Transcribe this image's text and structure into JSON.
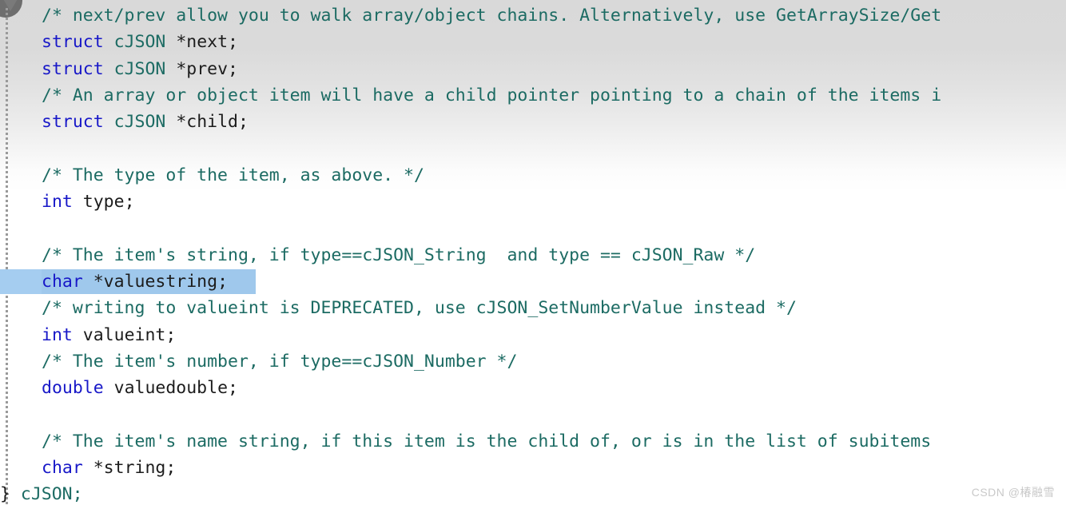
{
  "editor": {
    "language": "C",
    "colors": {
      "comment": "#1c6b63",
      "keyword": "#1818c8",
      "identifier": "#1c1c1c",
      "type": "#1c6b63",
      "selection_background": "#a5cdf0",
      "editor_background": "#ffffff"
    },
    "lines": [
      {
        "index": 0,
        "indent": true,
        "selected": false,
        "tokens": [
          {
            "kind": "cmt",
            "text": "/* next/prev allow you to walk array/object chains. Alternatively, use GetArraySize/Get"
          }
        ]
      },
      {
        "index": 1,
        "indent": true,
        "selected": false,
        "tokens": [
          {
            "kind": "kw",
            "text": "struct"
          },
          {
            "kind": "plain",
            "text": " "
          },
          {
            "kind": "typ",
            "text": "cJSON"
          },
          {
            "kind": "plain",
            "text": " "
          },
          {
            "kind": "id",
            "text": "*next;"
          }
        ]
      },
      {
        "index": 2,
        "indent": true,
        "selected": false,
        "tokens": [
          {
            "kind": "kw",
            "text": "struct"
          },
          {
            "kind": "plain",
            "text": " "
          },
          {
            "kind": "typ",
            "text": "cJSON"
          },
          {
            "kind": "plain",
            "text": " "
          },
          {
            "kind": "id",
            "text": "*prev;"
          }
        ]
      },
      {
        "index": 3,
        "indent": true,
        "selected": false,
        "tokens": [
          {
            "kind": "cmt",
            "text": "/* An array or object item will have a child pointer pointing to a chain of the items i"
          }
        ]
      },
      {
        "index": 4,
        "indent": true,
        "selected": false,
        "tokens": [
          {
            "kind": "kw",
            "text": "struct"
          },
          {
            "kind": "plain",
            "text": " "
          },
          {
            "kind": "typ",
            "text": "cJSON"
          },
          {
            "kind": "plain",
            "text": " "
          },
          {
            "kind": "id",
            "text": "*child;"
          }
        ]
      },
      {
        "index": 5,
        "indent": true,
        "selected": false,
        "tokens": []
      },
      {
        "index": 6,
        "indent": true,
        "selected": false,
        "tokens": [
          {
            "kind": "cmt",
            "text": "/* The type of the item, as above. */"
          }
        ]
      },
      {
        "index": 7,
        "indent": true,
        "selected": false,
        "tokens": [
          {
            "kind": "kw",
            "text": "int"
          },
          {
            "kind": "plain",
            "text": " "
          },
          {
            "kind": "id",
            "text": "type;"
          }
        ]
      },
      {
        "index": 8,
        "indent": true,
        "selected": false,
        "tokens": []
      },
      {
        "index": 9,
        "indent": true,
        "selected": false,
        "tokens": [
          {
            "kind": "cmt",
            "text": "/* The item's string, if type==cJSON_String  and type == cJSON_Raw */"
          }
        ]
      },
      {
        "index": 10,
        "indent": true,
        "selected": true,
        "tokens": [
          {
            "kind": "kw",
            "text": "char"
          },
          {
            "kind": "plain",
            "text": " "
          },
          {
            "kind": "id",
            "text": "*valuestring;"
          }
        ]
      },
      {
        "index": 11,
        "indent": true,
        "selected": false,
        "tokens": [
          {
            "kind": "cmt",
            "text": "/* writing to valueint is DEPRECATED, use cJSON_SetNumberValue instead */"
          }
        ]
      },
      {
        "index": 12,
        "indent": true,
        "selected": false,
        "tokens": [
          {
            "kind": "kw",
            "text": "int"
          },
          {
            "kind": "plain",
            "text": " "
          },
          {
            "kind": "id",
            "text": "valueint;"
          }
        ]
      },
      {
        "index": 13,
        "indent": true,
        "selected": false,
        "tokens": [
          {
            "kind": "cmt",
            "text": "/* The item's number, if type==cJSON_Number */"
          }
        ]
      },
      {
        "index": 14,
        "indent": true,
        "selected": false,
        "tokens": [
          {
            "kind": "kw",
            "text": "double"
          },
          {
            "kind": "plain",
            "text": " "
          },
          {
            "kind": "id",
            "text": "valuedouble;"
          }
        ]
      },
      {
        "index": 15,
        "indent": true,
        "selected": false,
        "tokens": []
      },
      {
        "index": 16,
        "indent": true,
        "selected": false,
        "tokens": [
          {
            "kind": "cmt",
            "text": "/* The item's name string, if this item is the child of, or is in the list of subitems"
          }
        ]
      },
      {
        "index": 17,
        "indent": true,
        "selected": false,
        "tokens": [
          {
            "kind": "kw",
            "text": "char"
          },
          {
            "kind": "plain",
            "text": " "
          },
          {
            "kind": "id",
            "text": "*string;"
          }
        ]
      },
      {
        "index": 18,
        "indent": false,
        "selected": false,
        "tokens": [
          {
            "kind": "plain",
            "text": "} "
          },
          {
            "kind": "typ",
            "text": "cJSON;"
          }
        ]
      }
    ]
  },
  "watermark": {
    "text": "CSDN @椿融雪"
  }
}
